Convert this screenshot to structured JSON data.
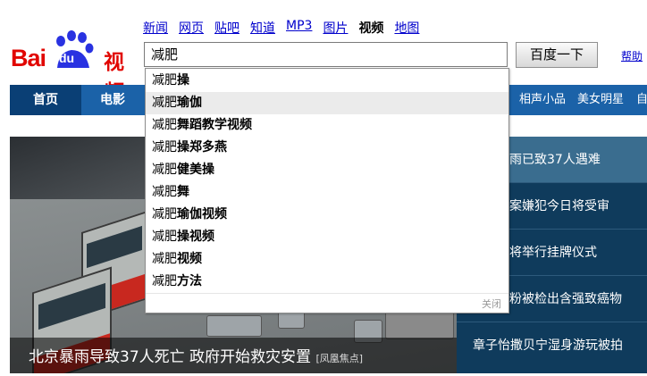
{
  "logo": {
    "text_latin": "Bai",
    "text_du": "du",
    "text_cn": "视频",
    "color": "#e10602"
  },
  "topnav": [
    {
      "label": "新闻",
      "active": false
    },
    {
      "label": "网页",
      "active": false
    },
    {
      "label": "贴吧",
      "active": false
    },
    {
      "label": "知道",
      "active": false
    },
    {
      "label": "MP3",
      "active": false
    },
    {
      "label": "图片",
      "active": false
    },
    {
      "label": "视频",
      "active": true
    },
    {
      "label": "地图",
      "active": false
    }
  ],
  "search": {
    "value": "减肥",
    "button_label": "百度一下",
    "help_label": "帮助"
  },
  "navbar": {
    "home": "首页",
    "movie": "电影",
    "right_items": [
      "相声小品",
      "美女明星",
      "自"
    ],
    "color": "#1b62a8"
  },
  "suggestions": {
    "items": [
      {
        "prefix": "减肥",
        "rest": "操"
      },
      {
        "prefix": "减肥",
        "rest": "瑜伽"
      },
      {
        "prefix": "减肥",
        "rest": "舞蹈教学视频"
      },
      {
        "prefix": "减肥",
        "rest": "操郑多燕"
      },
      {
        "prefix": "减肥",
        "rest": "健美操"
      },
      {
        "prefix": "减肥",
        "rest": "舞"
      },
      {
        "prefix": "减肥",
        "rest": "瑜伽视频"
      },
      {
        "prefix": "减肥",
        "rest": "操视频"
      },
      {
        "prefix": "减肥",
        "rest": "视频"
      },
      {
        "prefix": "减肥",
        "rest": "方法"
      }
    ],
    "highlighted_index": 1,
    "close_label": "关闭"
  },
  "feature": {
    "caption": "北京暴雨导致37人死亡 政府开始救灾安置",
    "source": "[凤凰焦点]"
  },
  "news": [
    "雨已致37人遇难",
    "案嫌犯今日将受审",
    "将举行挂牌仪式",
    "粉被检出含强致癌物",
    "章子怡撒贝宁湿身游玩被拍"
  ]
}
